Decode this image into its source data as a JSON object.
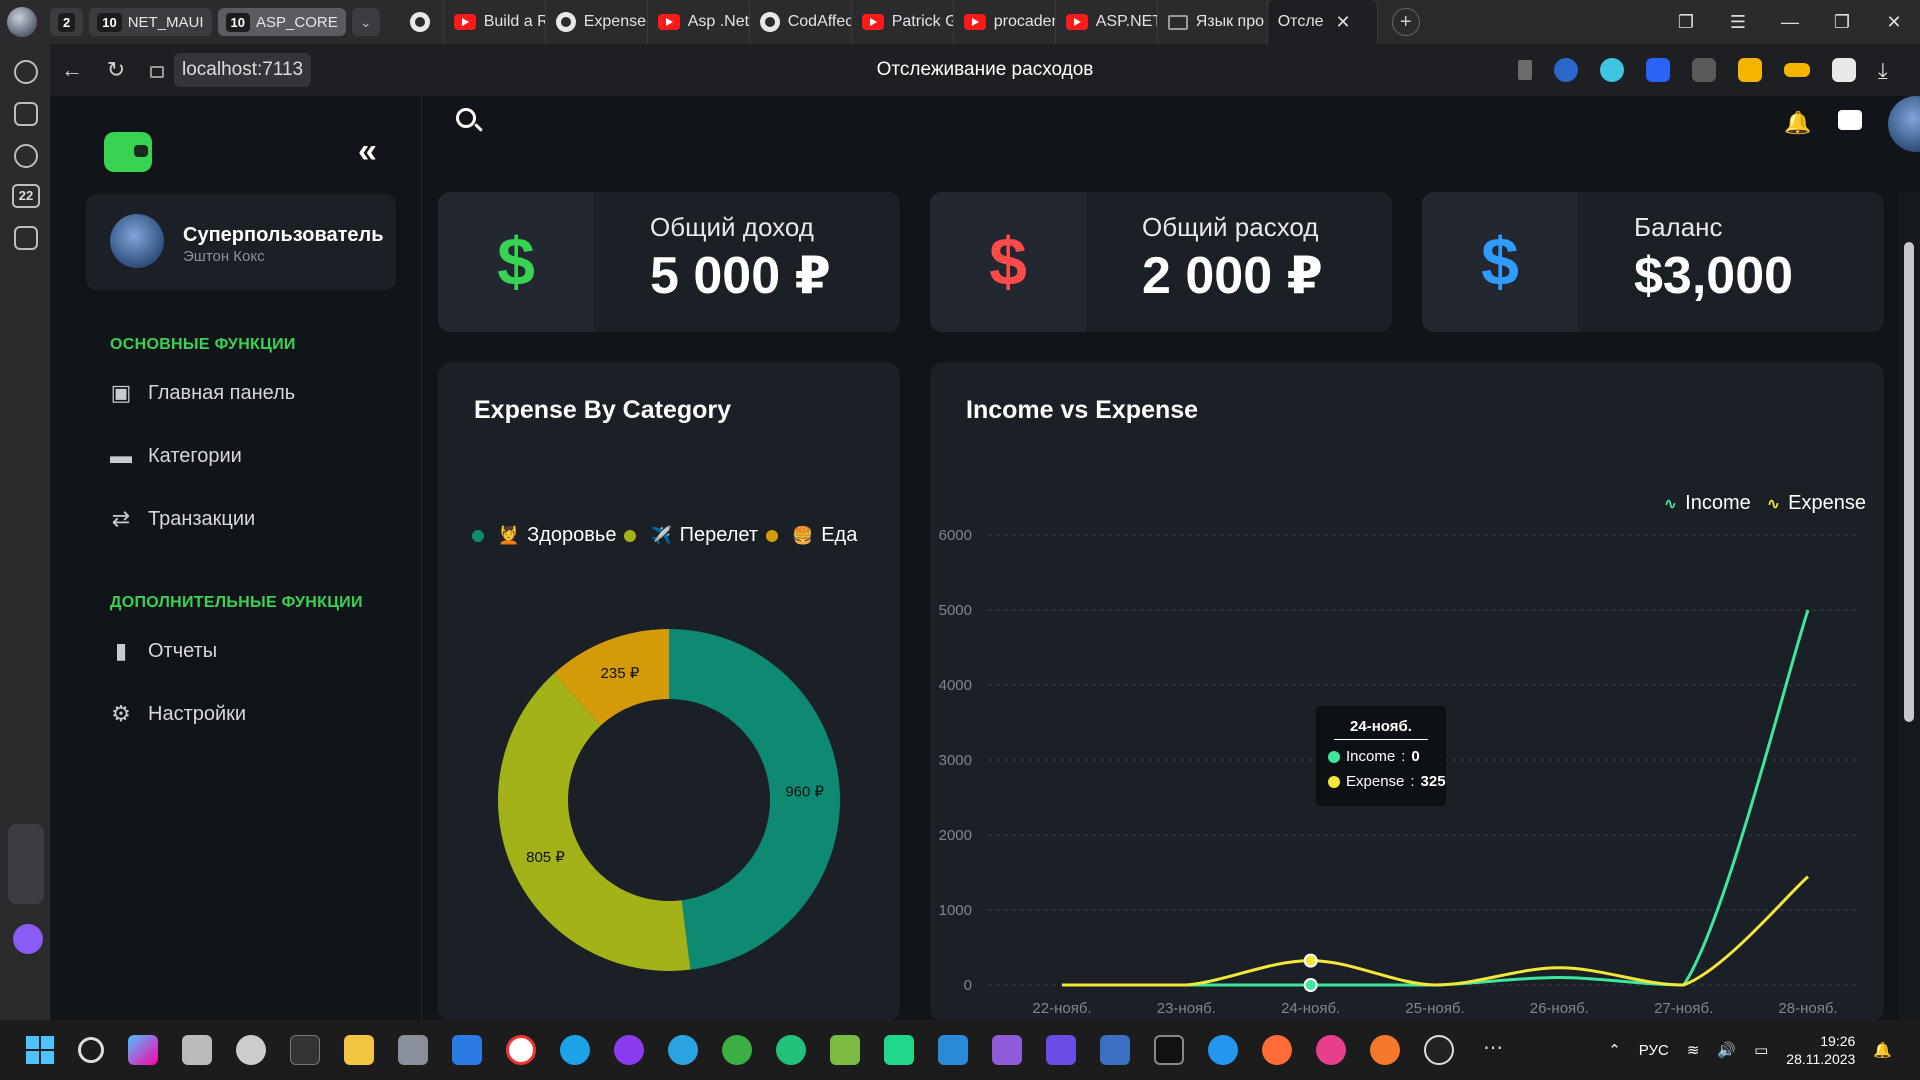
{
  "browser": {
    "tab_groups": [
      {
        "count": "2",
        "label": ""
      },
      {
        "count": "10",
        "label": "NET_MAUI"
      },
      {
        "count": "10",
        "label": "ASP_CORE"
      }
    ],
    "tabs": [
      {
        "icon": "github-icon",
        "label": ""
      },
      {
        "icon": "youtube-icon",
        "label": "Build a Re"
      },
      {
        "icon": "github-icon",
        "label": "Expense-"
      },
      {
        "icon": "youtube-icon",
        "label": "Asp .Net"
      },
      {
        "icon": "github-icon",
        "label": "CodAffec"
      },
      {
        "icon": "youtube-icon",
        "label": "Patrick G"
      },
      {
        "icon": "youtube-icon",
        "label": "procadem"
      },
      {
        "icon": "youtube-icon",
        "label": "ASP.NET"
      },
      {
        "icon": "mail-icon",
        "label": "Язык про"
      },
      {
        "icon": "app-icon",
        "label": "Отсле"
      }
    ],
    "url": "localhost:7113",
    "page_title": "Отслеживание расходов",
    "sidebar_badge": "22"
  },
  "sidebar": {
    "user_name": "Суперпользователь",
    "user_sub": "Эштон Кокс",
    "section_main": "ОСНОВНЫЕ ФУНКЦИИ",
    "section_extra": "ДОПОЛНИТЕЛЬНЫЕ ФУНКЦИИ",
    "items": [
      {
        "label": "Главная панель",
        "icon": "box-icon"
      },
      {
        "label": "Категории",
        "icon": "folder-icon"
      },
      {
        "label": "Транзакции",
        "icon": "transfer-icon"
      },
      {
        "label": "Отчеты",
        "icon": "bar-chart-icon"
      },
      {
        "label": "Настройки",
        "icon": "gear-icon"
      }
    ]
  },
  "stats": [
    {
      "label": "Общий доход",
      "value": "5 000 ₽",
      "icon": "dollar-icon",
      "color": "#39d353"
    },
    {
      "label": "Общий расход",
      "value": "2 000 ₽",
      "icon": "dollar-icon",
      "color": "#ff4a4a"
    },
    {
      "label": "Баланс",
      "value": "$3,000",
      "icon": "dollar-icon",
      "color": "#2f9bff"
    }
  ],
  "chart_data": [
    {
      "type": "pie",
      "title": "Expense By Category",
      "categories": [
        "Здоровье",
        "Перелет",
        "Еда"
      ],
      "category_emoji": [
        "💆",
        "✈️",
        "🍔"
      ],
      "values": [
        960,
        805,
        235
      ],
      "value_labels": [
        "960 ₽",
        "805 ₽",
        "235 ₽"
      ],
      "colors": [
        "#0f8a72",
        "#a4b21a",
        "#d49a0a"
      ],
      "legend": "top",
      "donut": true
    },
    {
      "type": "line",
      "title": "Income vs Expense",
      "x": [
        "22-нояб.",
        "23-нояб.",
        "24-нояб.",
        "25-нояб.",
        "26-нояб.",
        "27-нояб.",
        "28-нояб."
      ],
      "series": [
        {
          "name": "Income",
          "color": "#3ee89a",
          "values": [
            0,
            0,
            0,
            0,
            100,
            0,
            5000
          ]
        },
        {
          "name": "Expense",
          "color": "#f5e63a",
          "values": [
            0,
            0,
            325,
            0,
            230,
            0,
            1445
          ]
        }
      ],
      "y_ticks": [
        "0",
        "1000",
        "2000",
        "3000",
        "4000",
        "5000",
        "6000"
      ],
      "ylim": [
        0,
        6000
      ],
      "grid": true,
      "legend": "top-right",
      "tooltip": {
        "title": "24-нояб.",
        "income_label": "Income",
        "income_value": "0",
        "expense_label": "Expense",
        "expense_value": "325"
      }
    }
  ],
  "taskbar": {
    "lang": "РУС",
    "time": "19:26",
    "date": "28.11.2023"
  }
}
